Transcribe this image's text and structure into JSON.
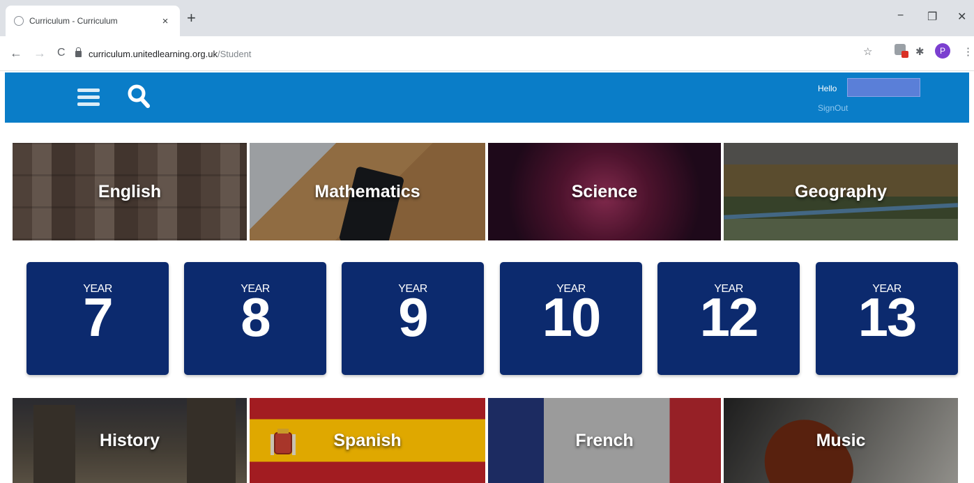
{
  "browser": {
    "tab_title": "Curriculum - Curriculum",
    "tab_close": "×",
    "new_tab": "+",
    "minimize": "−",
    "restore": "❐",
    "close_window": "✕",
    "back": "←",
    "forward": "→",
    "reload": "C",
    "url_host": "curriculum.unitedlearning.org.uk",
    "url_path": "/Student",
    "bookmark_star": "☆",
    "extensions_icon": "✱",
    "profile_initial": "P",
    "menu": "⋮"
  },
  "header": {
    "greeting": "Hello",
    "signout": "SignOut"
  },
  "subjects_top": [
    {
      "label": "English"
    },
    {
      "label": "Mathematics"
    },
    {
      "label": "Science"
    },
    {
      "label": "Geography"
    }
  ],
  "years": [
    {
      "label": "YEAR",
      "number": "7"
    },
    {
      "label": "YEAR",
      "number": "8"
    },
    {
      "label": "YEAR",
      "number": "9"
    },
    {
      "label": "YEAR",
      "number": "10"
    },
    {
      "label": "YEAR",
      "number": "12"
    },
    {
      "label": "YEAR",
      "number": "13"
    }
  ],
  "subjects_bottom": [
    {
      "label": "History"
    },
    {
      "label": "Spanish"
    },
    {
      "label": "French"
    },
    {
      "label": "Music"
    }
  ],
  "colors": {
    "header_blue": "#0a7dc8",
    "year_tile_navy": "#0c2a6e"
  }
}
